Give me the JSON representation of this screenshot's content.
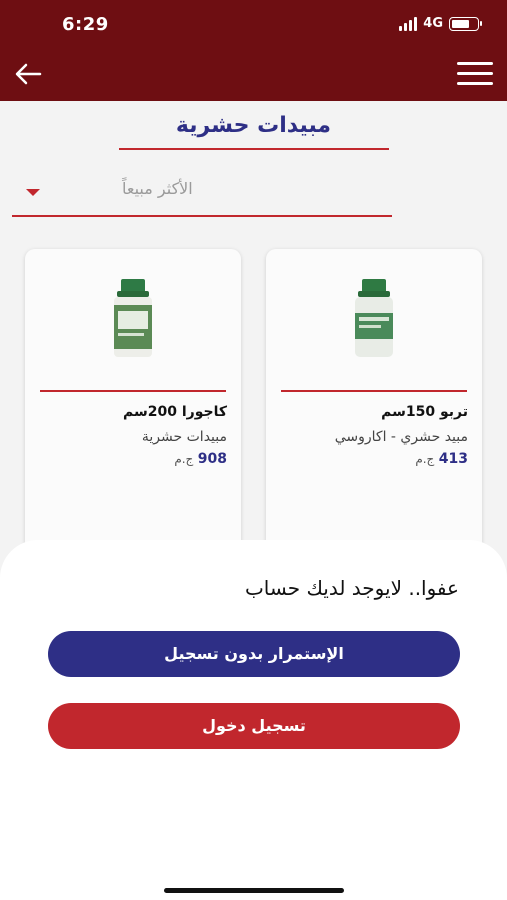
{
  "status_bar": {
    "time": "6:29",
    "network": "4G"
  },
  "app_bar": {
    "back_icon": "arrow-left-icon",
    "menu_icon": "hamburger-menu-icon"
  },
  "page": {
    "title": "مبيدات حشرية",
    "sort": {
      "selected": "الأكثر مبيعاً",
      "icon": "caret-down-icon"
    }
  },
  "products": [
    {
      "name": "تربو 150سم",
      "category": "مبيد حشري - اكاروسي",
      "price": "413",
      "currency": "ج.م"
    },
    {
      "name": "كاجورا 200سم",
      "category": "مبيدات حشرية",
      "price": "908",
      "currency": "ج.م"
    }
  ],
  "sheet": {
    "message": "عفوا.. لايوجد لديك حساب",
    "continue_label": "الإستمرار بدون تسجيل",
    "login_label": "تسجيل دخول"
  },
  "colors": {
    "header": "#6e0e12",
    "primary_blue": "#2e2f86",
    "accent_red": "#c1272d",
    "overlay_bg": "#f3f3f3"
  }
}
